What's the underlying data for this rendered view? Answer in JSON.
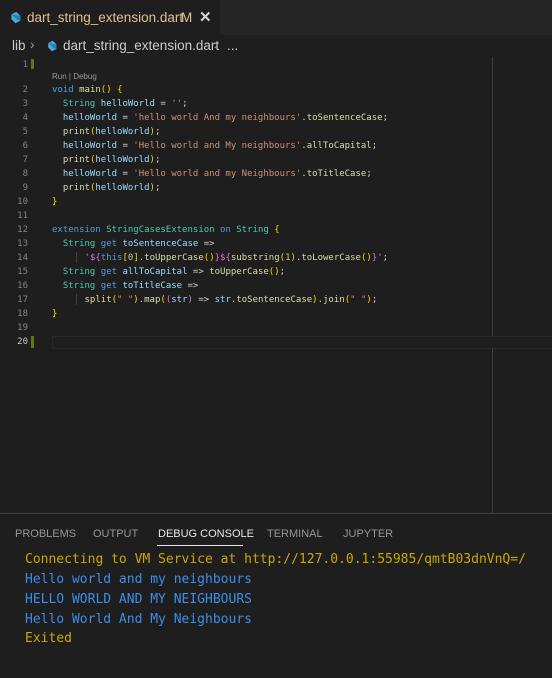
{
  "tab": {
    "title": "dart_string_extension.dart",
    "modified_marker": "M",
    "close_glyph": "✕",
    "icon": "dart-icon",
    "title_color": "#e2c08d"
  },
  "breadcrumb": {
    "folder": "lib",
    "separator": "›",
    "file": "dart_string_extension.dart",
    "more": "..."
  },
  "editor": {
    "codelens": "Run | Debug",
    "line_numbers": [
      "1",
      "2",
      "3",
      "4",
      "5",
      "6",
      "7",
      "8",
      "9",
      "10",
      "11",
      "12",
      "13",
      "14",
      "15",
      "16",
      "17",
      "18",
      "19",
      "20"
    ],
    "active_line": "20",
    "lines": [
      "",
      "void main() {",
      "  String helloWorld = '';",
      "  helloWorld = 'hello world And my neighbours'.toSentenceCase;",
      "  print(helloWorld);",
      "  helloWorld = 'Hello world and My neighbours'.allToCapital;",
      "  print(helloWorld);",
      "  helloWorld = 'Hello world and my Neighbours'.toTitleCase;",
      "  print(helloWorld);",
      "}",
      "",
      "extension StringCasesExtension on String {",
      "  String get toSentenceCase =>",
      "      '${this[0].toUpperCase()}${substring(1).toLowerCase()}';",
      "  String get allToCapital => toUpperCase();",
      "  String get toTitleCase =>",
      "      split(\" \").map((str) => str.toSentenceCase).join(\" \");",
      "}",
      "",
      ""
    ]
  },
  "panel": {
    "tabs": [
      "PROBLEMS",
      "OUTPUT",
      "DEBUG CONSOLE",
      "TERMINAL",
      "JUPYTER"
    ],
    "active_tab": "DEBUG CONSOLE",
    "console": [
      "Connecting to VM Service at http://127.0.0.1:55985/qmtB03dnVnQ=/",
      "Hello world and my neighbours",
      "HELLO WORLD AND MY NEIGHBOURS",
      "Hello World And My Neighbours",
      "Exited"
    ],
    "console_colors": {
      "status": "#cca700",
      "output": "#3b8eea"
    }
  }
}
